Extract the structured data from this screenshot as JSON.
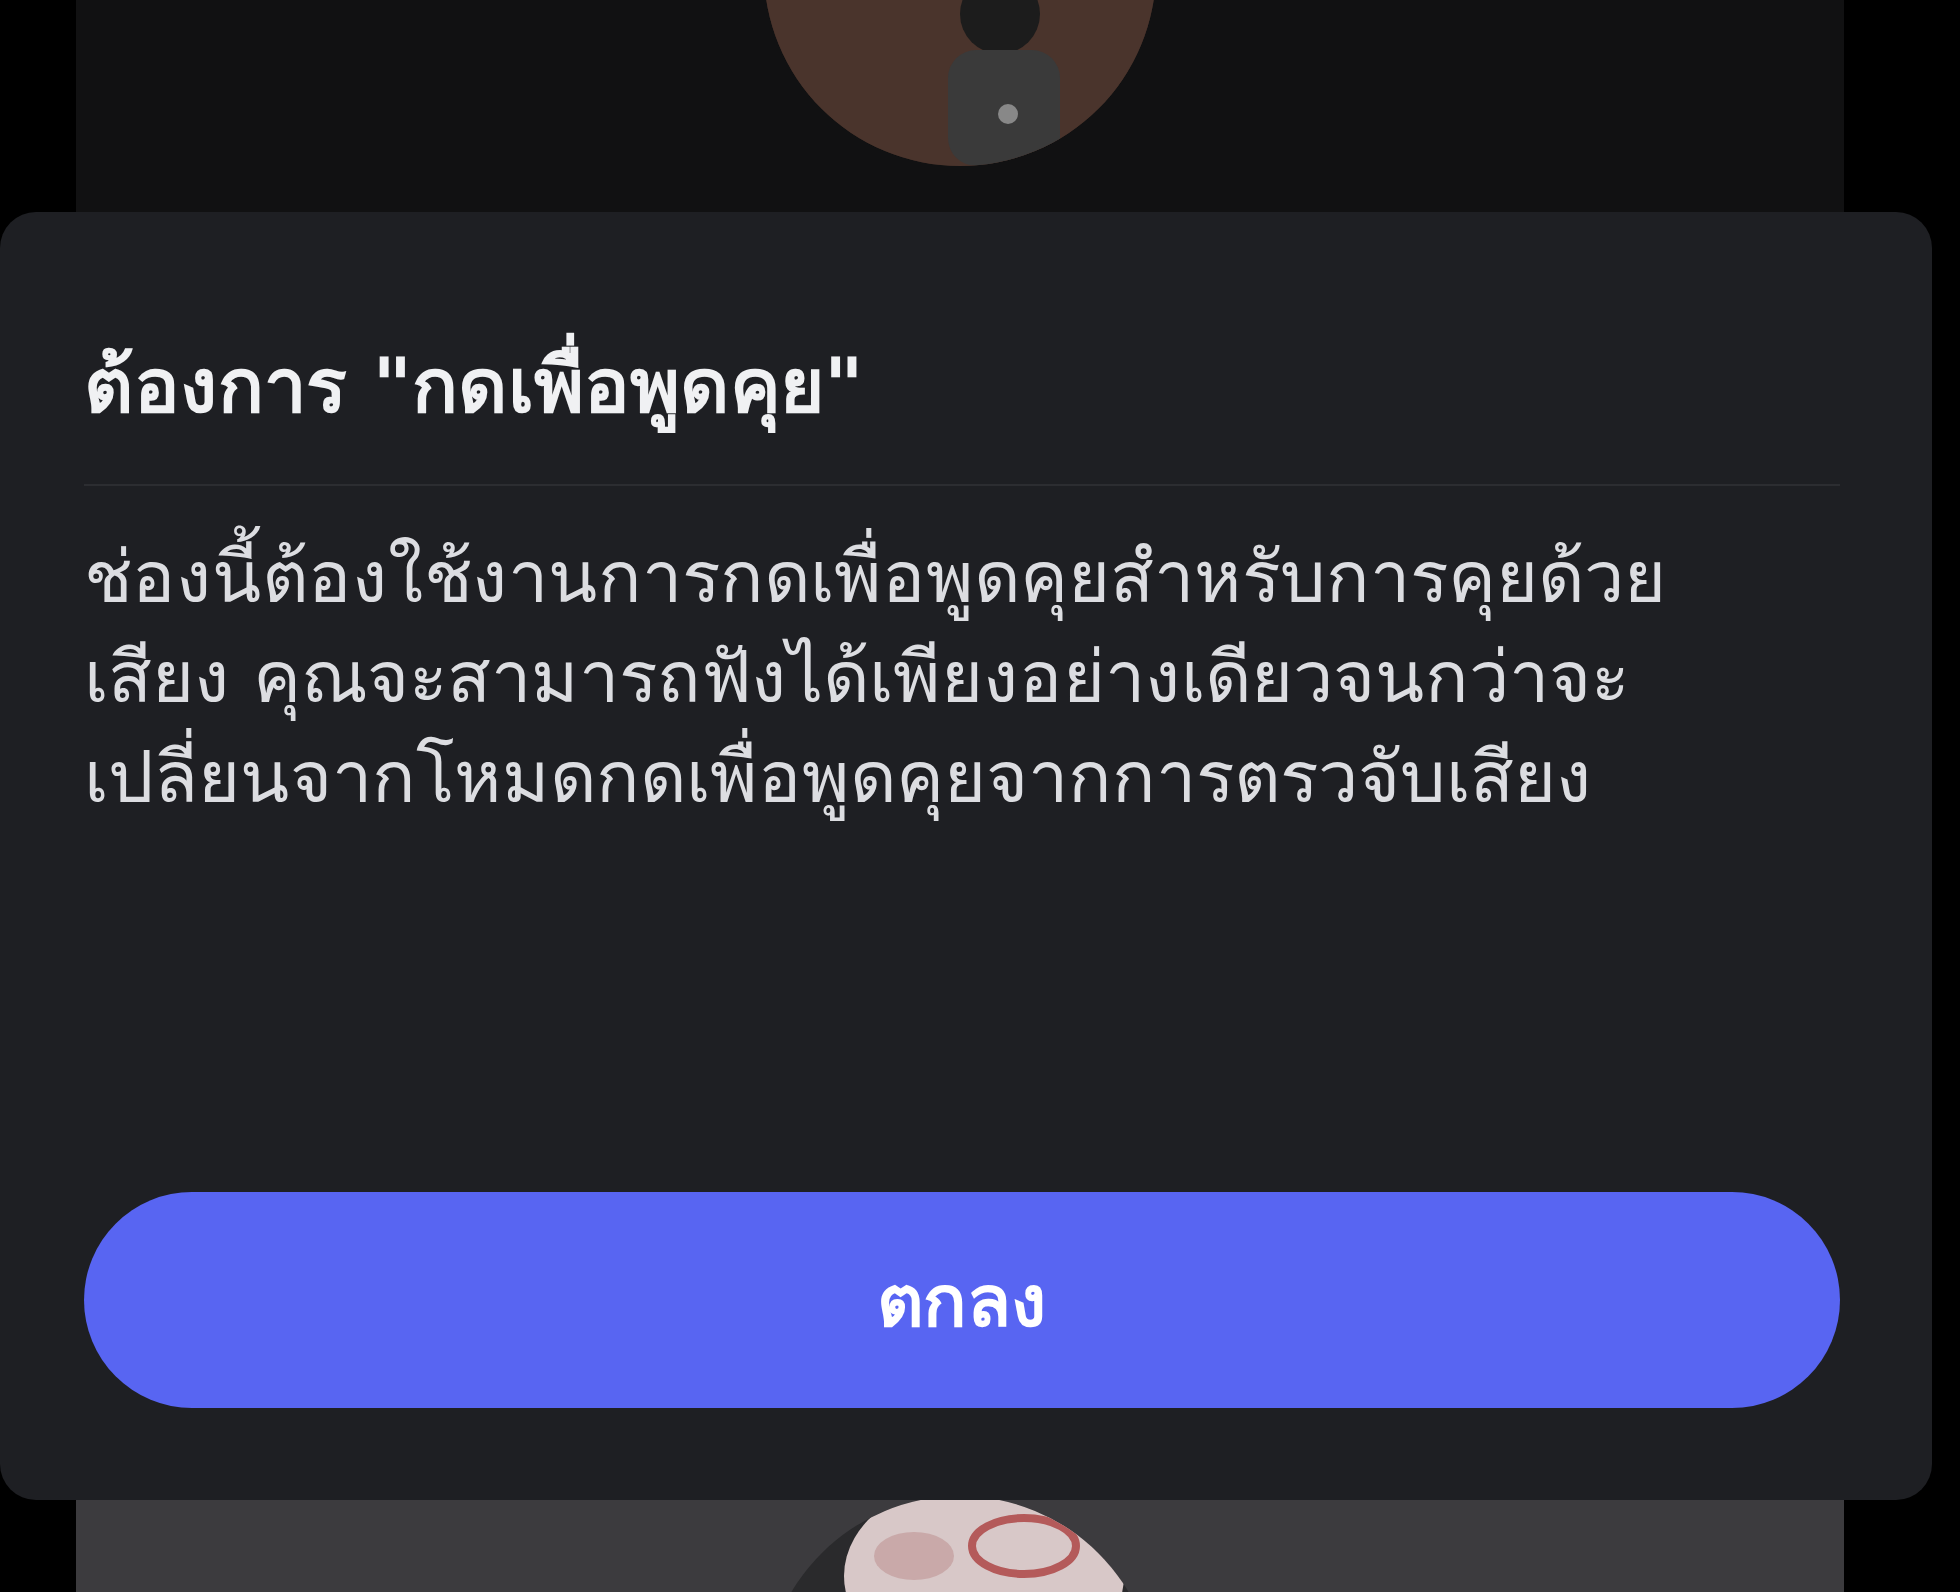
{
  "dialog": {
    "title": "ต้องการ \"กดเพื่อพูดคุย\"",
    "message": "ช่องนี้ต้องใช้งานการกดเพื่อพูดคุยสำหรับการคุยด้วยเสียง คุณจะสามารถฟังได้เพียงอย่างเดียวจนกว่าจะเปลี่ยนจากโหมดกดเพื่อพูดคุยจากการตรวจับเสียง",
    "buttons": [
      "ตกลง"
    ]
  }
}
